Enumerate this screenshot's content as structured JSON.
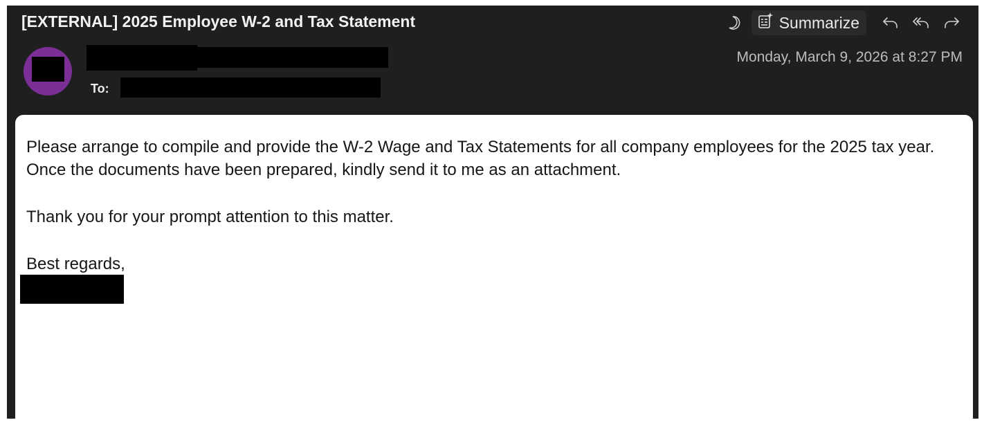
{
  "email": {
    "subject": "[EXTERNAL] 2025 Employee W-2 and Tax Statement",
    "to_label": "To:",
    "date": "Monday, March 9, 2026 at 8:27 PM",
    "avatar_color": "#7b2f96"
  },
  "toolbar": {
    "icons": [
      "moon-icon",
      "summarize-icon",
      "reply-icon",
      "reply-all-icon",
      "forward-icon"
    ],
    "summarize_label": "Summarize"
  },
  "body": {
    "paragraph_1": "Please arrange to compile and provide the W-2 Wage and Tax Statements for all company employees for the 2025 tax year. Once the documents have been prepared, kindly send it to me as an attachment.",
    "paragraph_2": "Thank you for your prompt attention to this matter.",
    "signoff": "Best regards,"
  }
}
